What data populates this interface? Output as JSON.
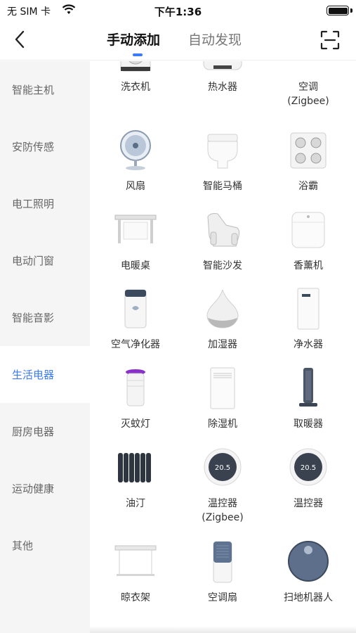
{
  "status_bar": {
    "carrier": "无 SIM 卡",
    "time": "下午1:36"
  },
  "nav": {
    "tab_manual": "手动添加",
    "tab_auto": "自动发现",
    "accent": "#3b7bf6"
  },
  "sidebar": {
    "items": [
      {
        "label": "智能主机"
      },
      {
        "label": "安防传感"
      },
      {
        "label": "电工照明"
      },
      {
        "label": "电动门窗"
      },
      {
        "label": "智能音影"
      },
      {
        "label": "生活电器",
        "active": true
      },
      {
        "label": "厨房电器"
      },
      {
        "label": "运动健康"
      },
      {
        "label": "其他"
      }
    ]
  },
  "devices": [
    {
      "label": "洗衣机",
      "icon": "washing-machine-icon"
    },
    {
      "label": "热水器",
      "icon": "water-heater-icon"
    },
    {
      "label": "空调",
      "sub": "(Zigbee)",
      "icon": "air-conditioner-icon"
    },
    {
      "label": "风扇",
      "icon": "fan-icon"
    },
    {
      "label": "智能马桶",
      "icon": "smart-toilet-icon"
    },
    {
      "label": "浴霸",
      "icon": "bath-heater-icon"
    },
    {
      "label": "电暖桌",
      "icon": "heated-table-icon"
    },
    {
      "label": "智能沙发",
      "icon": "smart-sofa-icon"
    },
    {
      "label": "香薰机",
      "icon": "aroma-diffuser-icon"
    },
    {
      "label": "空气净化器",
      "icon": "air-purifier-icon"
    },
    {
      "label": "加湿器",
      "icon": "humidifier-icon"
    },
    {
      "label": "净水器",
      "icon": "water-purifier-icon"
    },
    {
      "label": "灭蚊灯",
      "icon": "mosquito-lamp-icon"
    },
    {
      "label": "除湿机",
      "icon": "dehumidifier-icon"
    },
    {
      "label": "取暖器",
      "icon": "heater-icon"
    },
    {
      "label": "油汀",
      "icon": "oil-radiator-icon"
    },
    {
      "label": "温控器",
      "sub": "(Zigbee)",
      "icon": "thermostat-icon",
      "reading": "20.5"
    },
    {
      "label": "温控器",
      "icon": "thermostat-icon",
      "reading": "20.5"
    },
    {
      "label": "晾衣架",
      "icon": "clothes-rack-icon"
    },
    {
      "label": "空调扇",
      "icon": "air-cooler-fan-icon"
    },
    {
      "label": "扫地机器人",
      "icon": "robot-vacuum-icon"
    }
  ]
}
